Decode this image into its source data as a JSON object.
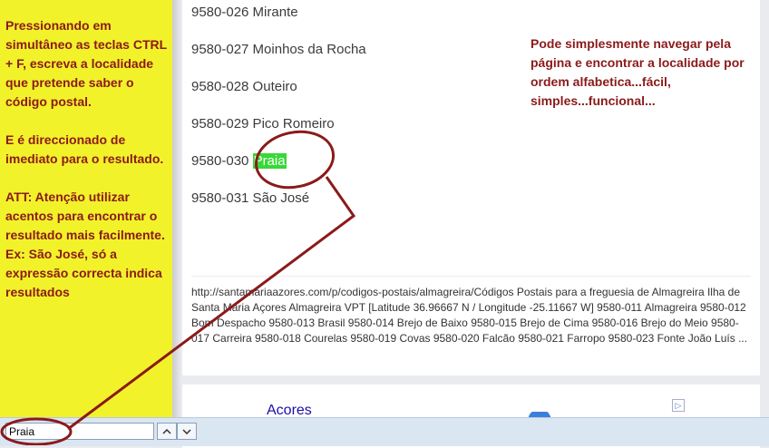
{
  "sidebar_note": {
    "para1": "Pressionando em simultâneo as teclas CTRL + F, escreva a localidade que pretende saber o código postal.",
    "para2": "E é direccionado de imediato para o resultado.",
    "para3": "ATT: Atenção utilizar acentos para encontrar o resultado mais facilmente.",
    "para4": "Ex: São José, só a expressão correcta indica resultados"
  },
  "entries": [
    {
      "text": "9580-026 Mirante"
    },
    {
      "text": "9580-027 Moinhos da Rocha"
    },
    {
      "text": "9580-028 Outeiro"
    },
    {
      "text": "9580-029 Pico Romeiro"
    },
    {
      "code": "9580-030",
      "match": "Praia"
    },
    {
      "text": "9580-031 São José"
    }
  ],
  "right_note": "Pode simplesmente navegar pela página e encontrar a localidade por ordem alfabetica...fácil, simples...funcional...",
  "snippet": "http://santamariaazores.com/p/codigos-postais/almagreira/Códigos Postais para a freguesia de Almagreira Ilha de Santa Maria Açores Almagreira VPT [Latitude 36.96667 N / Longitude -25.11667 W]   9580-011 Almagreira 9580-012 Bom Despacho 9580-013 Brasil 9580-014 Brejo de Baixo 9580-015 Brejo de Cima 9580-016 Brejo do Meio 9580-017 Carreira 9580-018 Courelas 9580-019 Covas 9580-020 Falcão 9580-021 Farropo 9580-023 Fonte João Luís ...",
  "ad": {
    "title": "Acores",
    "badge": "▷"
  },
  "find_bar": {
    "value": "Praia",
    "prev_icon": "chevron-up-icon",
    "next_icon": "chevron-down-icon"
  },
  "colors": {
    "annotation": "#8b1a1a",
    "sidebar_bg": "#f2f22a",
    "highlight": "#38d838"
  }
}
